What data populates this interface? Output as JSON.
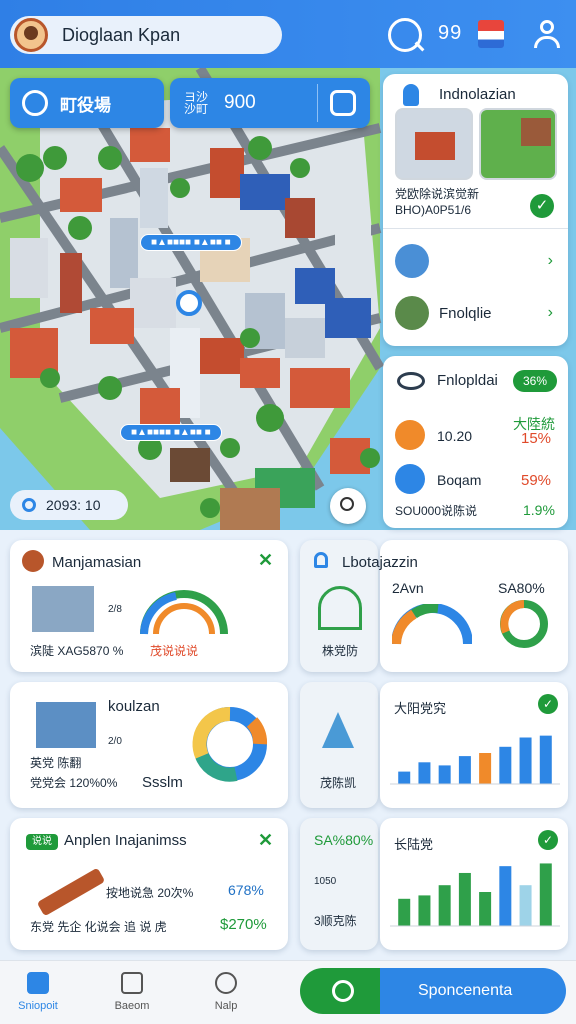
{
  "header": {
    "username": "Dioglaan Kpan",
    "notification_count": "99"
  },
  "map": {
    "pill_left_label": "町役場",
    "pill_right_label": "ヨ沙\n沙町",
    "pill_right_value": "900",
    "stat_label": "2093: 10",
    "tags": [
      "■▲■■■■ ■▲■■ ■"
    ]
  },
  "right_panel": {
    "card1_title": "Indnolazian",
    "card1_desc": "党欧除说滨觉新\nBHO)A0P51/6",
    "row1_label": "",
    "row2_label": "Fnolqlie",
    "card2_title": "Fnlopldai",
    "card2_badge": "36%",
    "item1_value": "10.20",
    "item1_cn": "大陸統",
    "item1_pct": "15%",
    "item2_label": "Boqam",
    "item2_pct": "59%",
    "item3_label": "SOU000说陈说",
    "item3_pct": "1.9%"
  },
  "cards": {
    "c1_title": "Manjamasian",
    "c1_line": "滨陡 XAG5870 %",
    "c1_gauge_label": "茂说说说",
    "c1_axis": "2/8",
    "c2_title": "Lbotajazzin",
    "c2_label": "2Avn",
    "c2_pct": "SA80%",
    "c2_sub": "株党防",
    "c3_title": "koulzan",
    "c3_axis": "2/0",
    "c3_line1": "英党 陈翻",
    "c3_line2": "党党会 120%0%",
    "c3_val": "Ssslm",
    "c4_sub": "茂陈凯",
    "c5_title": "大阳党究",
    "c6_badge": "说说",
    "c6_title": "Anplen Inajanimss",
    "c6_line1": "按地说急 20次%",
    "c6_val1": "678%",
    "c6_line2": "东党 先企 化说会 追 说 虎",
    "c6_val2": "$270%",
    "c7_title": "SA%80%",
    "c7_sub1": "1050",
    "c7_sub2": "3顺克陈",
    "c8_title": "长陆党"
  },
  "nav": {
    "home": "Sniopoit",
    "item2": "Baeom",
    "item3": "Nalp",
    "primary": "Sponcenenta"
  },
  "bar_chart1": {
    "values": [
      20,
      35,
      30,
      45,
      50,
      60,
      75,
      78
    ],
    "colors": [
      "#2d86e5",
      "#2d86e5",
      "#2d86e5",
      "#2d86e5",
      "#f08a2a",
      "#2d86e5",
      "#2d86e5",
      "#2d86e5"
    ]
  },
  "bar_chart2": {
    "values": [
      40,
      45,
      60,
      78,
      50,
      88,
      60,
      92
    ],
    "colors": [
      "#2fa04a",
      "#2fa04a",
      "#2fa04a",
      "#2fa04a",
      "#2fa04a",
      "#2d86e5",
      "#9ed3e8",
      "#2fa04a"
    ]
  }
}
